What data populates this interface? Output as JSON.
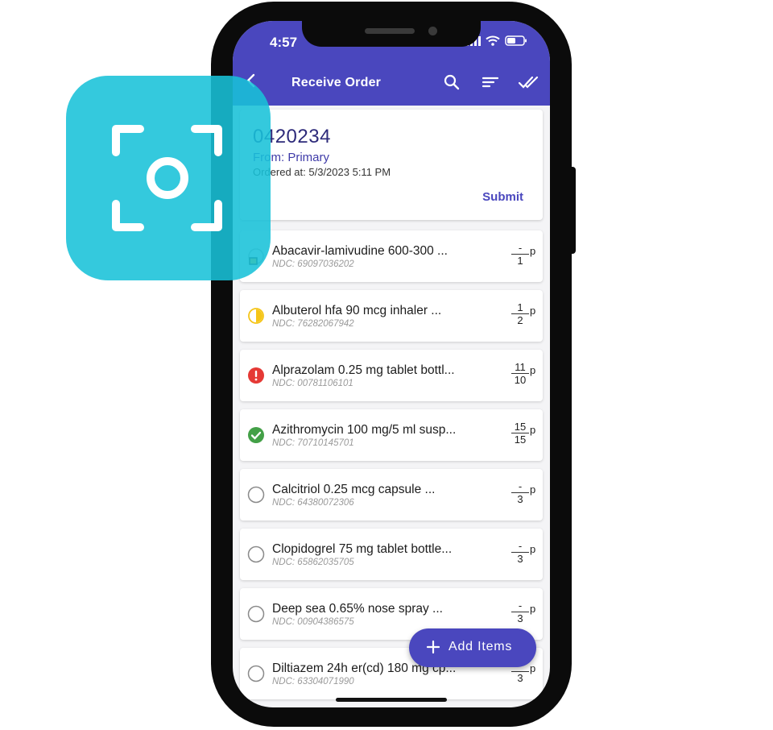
{
  "status_bar": {
    "time": "4:57"
  },
  "app_bar": {
    "title": "Receive Order",
    "actions": [
      "search-icon",
      "sort-icon",
      "done-all-icon"
    ]
  },
  "order": {
    "number": "0420234",
    "from": "From: Primary",
    "ordered_at": "Ordered at: 5/3/2023 5:11 PM",
    "submit_label": "Submit"
  },
  "items": [
    {
      "name": "Abacavir-lamivudine 600-300 ...",
      "ndc": "NDC: 69097036202",
      "received": "-",
      "ordered": "1",
      "unit": "p",
      "status": "partial-flag"
    },
    {
      "name": "Albuterol hfa 90 mcg inhaler ...",
      "ndc": "NDC: 76282067942",
      "received": "1",
      "ordered": "2",
      "unit": "p",
      "status": "half"
    },
    {
      "name": "Alprazolam 0.25 mg tablet bottl...",
      "ndc": "NDC: 00781106101",
      "received": "11",
      "ordered": "10",
      "unit": "p",
      "status": "error"
    },
    {
      "name": "Azithromycin 100 mg/5 ml susp...",
      "ndc": "NDC: 70710145701",
      "received": "15",
      "ordered": "15",
      "unit": "p",
      "status": "complete"
    },
    {
      "name": "Calcitriol 0.25 mcg capsule ...",
      "ndc": "NDC: 64380072306",
      "received": "-",
      "ordered": "3",
      "unit": "p",
      "status": "empty"
    },
    {
      "name": "Clopidogrel 75 mg tablet bottle...",
      "ndc": "NDC: 65862035705",
      "received": "-",
      "ordered": "3",
      "unit": "p",
      "status": "empty"
    },
    {
      "name": "Deep sea 0.65% nose spray ...",
      "ndc": "NDC: 00904386575",
      "received": "-",
      "ordered": "3",
      "unit": "p",
      "status": "empty"
    },
    {
      "name": "Diltiazem 24h er(cd) 180 mg cp...",
      "ndc": "NDC: 63304071990",
      "received": "-",
      "ordered": "3",
      "unit": "p",
      "status": "empty"
    }
  ],
  "fab": {
    "label": "Add Items"
  },
  "overlay": {
    "icon": "scan-icon",
    "color": "#18c1d8"
  },
  "colors": {
    "primary": "#4a47be",
    "warning": "#f5c518",
    "error": "#e53935",
    "success": "#43a047"
  }
}
